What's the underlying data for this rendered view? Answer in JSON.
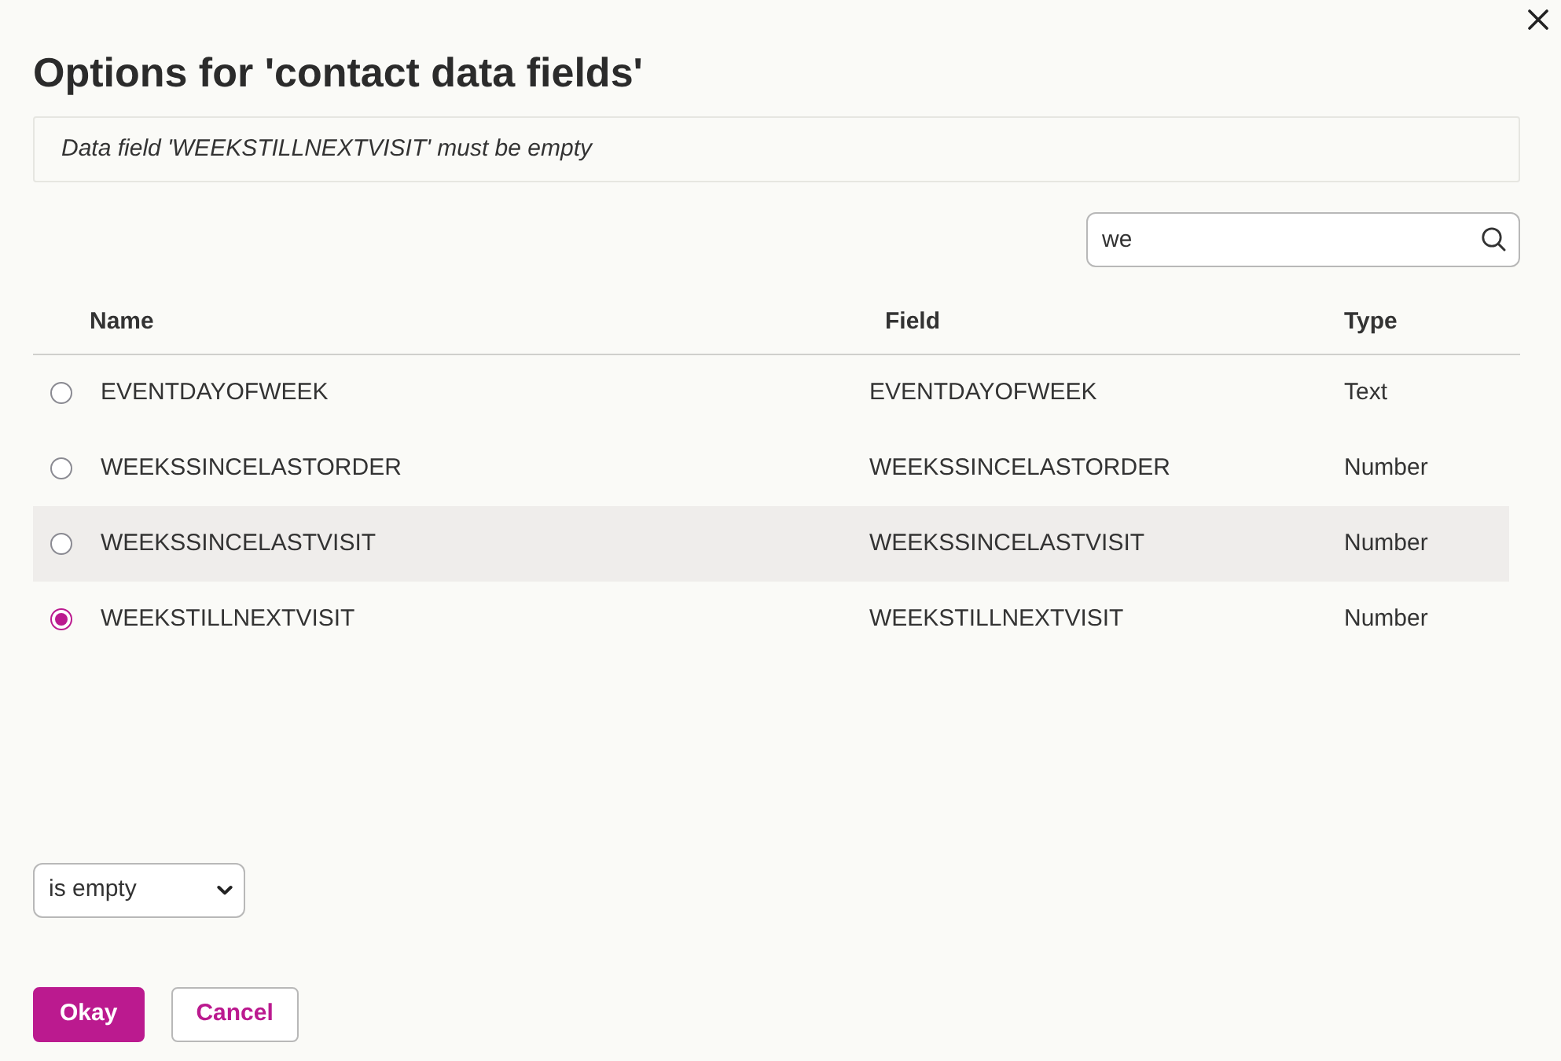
{
  "dialog": {
    "title": "Options for 'contact data fields'"
  },
  "message": "Data field 'WEEKSTILLNEXTVISIT' must be empty",
  "search": {
    "value": "we"
  },
  "table": {
    "columns": [
      "Name",
      "Field",
      "Type"
    ],
    "rows": [
      {
        "name": "EVENTDAYOFWEEK",
        "field": "EVENTDAYOFWEEK",
        "type": "Text",
        "selected": false,
        "highlighted": false
      },
      {
        "name": "WEEKSSINCELASTORDER",
        "field": "WEEKSSINCELASTORDER",
        "type": "Number",
        "selected": false,
        "highlighted": false
      },
      {
        "name": "WEEKSSINCELASTVISIT",
        "field": "WEEKSSINCELASTVISIT",
        "type": "Number",
        "selected": false,
        "highlighted": true
      },
      {
        "name": "WEEKSTILLNEXTVISIT",
        "field": "WEEKSTILLNEXTVISIT",
        "type": "Number",
        "selected": true,
        "highlighted": false
      }
    ]
  },
  "condition": {
    "value": "is empty"
  },
  "buttons": [
    {
      "label": "Okay",
      "kind": "primary"
    },
    {
      "label": "Cancel",
      "kind": "secondary"
    }
  ]
}
